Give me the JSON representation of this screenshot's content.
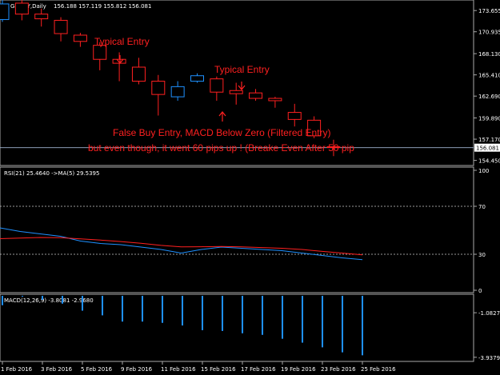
{
  "header": {
    "symbol_label": "GBPJPY,Daily",
    "ohlc_label": "156.188 157.119 155.812 156.081"
  },
  "colors": {
    "background": "#000000",
    "panel_border": "#aaaaaa",
    "grid_text": "#ffffff",
    "bull_candle": "#1e90ff",
    "bear_candle": "#ff2020",
    "rsi_line": "#1e90ff",
    "rsi_ma_line": "#ff2020",
    "macd_histogram": "#1e90ff",
    "price_line": "#a0b4d0",
    "annotation": "#ff2020"
  },
  "chart_data": [
    {
      "type": "candlestick",
      "ylim": [
        154.0,
        174.8
      ],
      "yticks": [
        "173.655",
        "170.935",
        "168.130",
        "165.410",
        "162.690",
        "159.890",
        "157.170",
        "154.450"
      ],
      "current_price": "156.081",
      "x_labels": [
        "1 Feb 2016",
        "3 Feb 2016",
        "5 Feb 2016",
        "9 Feb 2016",
        "11 Feb 2016",
        "15 Feb 2016",
        "17 Feb 2016",
        "19 Feb 2016",
        "23 Feb 2016",
        "25 Feb 2016"
      ],
      "candles": [
        {
          "o": 172.5,
          "h": 175.2,
          "l": 172.2,
          "c": 174.5
        },
        {
          "o": 174.6,
          "h": 175.2,
          "l": 172.4,
          "c": 173.2
        },
        {
          "o": 173.2,
          "h": 173.9,
          "l": 171.6,
          "c": 172.6
        },
        {
          "o": 172.4,
          "h": 172.8,
          "l": 169.7,
          "c": 170.7
        },
        {
          "o": 170.5,
          "h": 170.8,
          "l": 169.0,
          "c": 169.7
        },
        {
          "o": 169.2,
          "h": 169.6,
          "l": 166.0,
          "c": 167.4
        },
        {
          "o": 167.4,
          "h": 168.3,
          "l": 164.6,
          "c": 166.9
        },
        {
          "o": 166.4,
          "h": 167.6,
          "l": 164.2,
          "c": 164.6
        },
        {
          "o": 164.6,
          "h": 165.4,
          "l": 160.2,
          "c": 162.9
        },
        {
          "o": 162.6,
          "h": 164.6,
          "l": 162.1,
          "c": 163.9
        },
        {
          "o": 164.6,
          "h": 165.6,
          "l": 164.4,
          "c": 165.3
        },
        {
          "o": 164.9,
          "h": 165.2,
          "l": 162.1,
          "c": 163.2
        },
        {
          "o": 163.4,
          "h": 164.4,
          "l": 161.6,
          "c": 163.0
        },
        {
          "o": 163.1,
          "h": 163.6,
          "l": 162.1,
          "c": 162.4
        },
        {
          "o": 162.4,
          "h": 162.6,
          "l": 161.2,
          "c": 162.1
        },
        {
          "o": 160.6,
          "h": 161.7,
          "l": 158.8,
          "c": 159.7
        },
        {
          "o": 159.6,
          "h": 160.1,
          "l": 157.3,
          "c": 157.6
        },
        {
          "o": 156.2,
          "h": 157.1,
          "l": 155.0,
          "c": 156.1
        }
      ]
    },
    {
      "type": "line",
      "name": "RSI(21) 25.4640 ->MA(5) 29.5395",
      "ylim": [
        0,
        100
      ],
      "yticks": [
        "100",
        "70",
        "30",
        "0"
      ],
      "levels": [
        70,
        30
      ],
      "series": [
        {
          "name": "RSI(21)",
          "values": [
            52,
            49,
            47,
            45,
            41,
            39,
            38,
            36,
            34,
            31,
            34,
            36,
            35,
            34,
            33,
            31,
            29,
            27,
            25.5
          ]
        },
        {
          "name": "MA(5)",
          "values": [
            43,
            43.5,
            44,
            43.8,
            42.8,
            41.8,
            40.6,
            39.2,
            37.4,
            36.2,
            36.3,
            36.5,
            36.2,
            35.6,
            35.0,
            34.0,
            32.4,
            31.0,
            29.5
          ]
        }
      ]
    },
    {
      "type": "bar",
      "name": "MACD(12,26,9) -3.8081 -2.9680",
      "ylim": [
        -4.1,
        0
      ],
      "yticks": [
        "-1.0827",
        "-3.9379"
      ],
      "values": [
        -0.6,
        -0.05,
        -0.25,
        -0.5,
        -0.95,
        -1.25,
        -1.65,
        -1.65,
        -1.73,
        -1.9,
        -2.2,
        -2.25,
        -2.4,
        -2.5,
        -2.75,
        -3.0,
        -3.3,
        -3.62,
        -3.81
      ]
    }
  ],
  "annotations": {
    "typical_entry_1": "Typical Entry",
    "typical_entry_2": "Typical Entry",
    "false_buy_line1": "False Buy Entry, MACD Below Zero (Filtered Entry)",
    "false_buy_line2": "but even though, it went 60 pips up ! (Breake Even After 50 pip"
  }
}
